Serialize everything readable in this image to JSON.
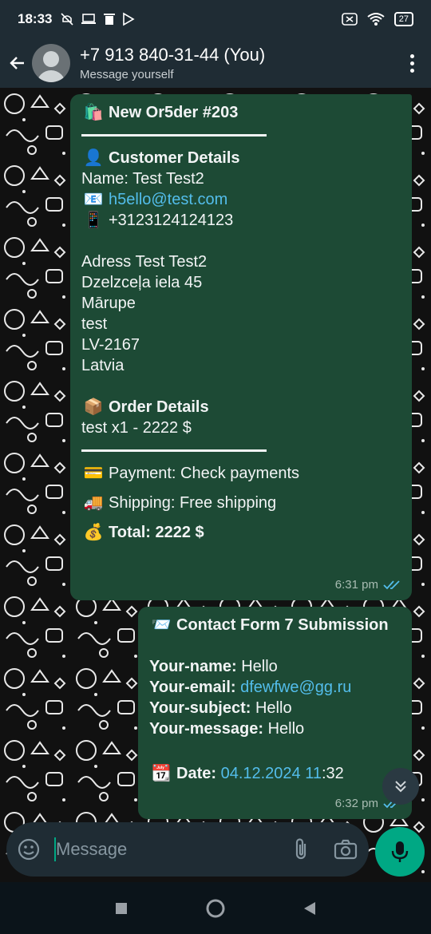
{
  "status_bar": {
    "time": "18:33",
    "battery": "27"
  },
  "header": {
    "title": "+7 913 840-31-44 (You)",
    "subtitle": "Message yourself"
  },
  "messages": [
    {
      "lines": {
        "title": "New Or5der #203",
        "customer_heading": "Customer Details",
        "name": "Name: Test Test2",
        "email": "h5ello@test.com",
        "phone": "+3123124124123",
        "address1": "Adress Test Test2",
        "address2": "Dzelzceļa iela 45",
        "address3": "Mārupe",
        "address4": "test",
        "address5": "LV-2167",
        "address6": "Latvia",
        "order_heading": "Order Details",
        "item": "test x1 - 2222 $",
        "payment": "Payment: Check payments",
        "shipping": "Shipping: Free shipping",
        "total": "Total: 2222 $"
      },
      "time": "6:31 pm"
    },
    {
      "lines": {
        "title": "Contact Form 7 Submission",
        "name_label": "Your-name:",
        "name_value": "Hello",
        "email_label": "Your-email:",
        "email_value": "dfewfwe@gg.ru",
        "subject_label": "Your-subject:",
        "subject_value": "Hello",
        "message_label": "Your-message:",
        "message_value": "Hello",
        "date_label": "Date:",
        "date_value": "04.12.2024 11",
        "date_suffix": ":32"
      },
      "time": "6:32 pm"
    }
  ],
  "composer": {
    "placeholder": "Message"
  },
  "colors": {
    "bubble": "#1d4a35",
    "accent": "#00a884",
    "link": "#53bdeb",
    "header": "#1f2c34"
  },
  "icons": [
    "back-arrow-icon",
    "menu-dots-icon",
    "emoji-icon",
    "attach-icon",
    "camera-icon",
    "mic-icon",
    "double-check-icon",
    "chevron-double-down-icon"
  ]
}
